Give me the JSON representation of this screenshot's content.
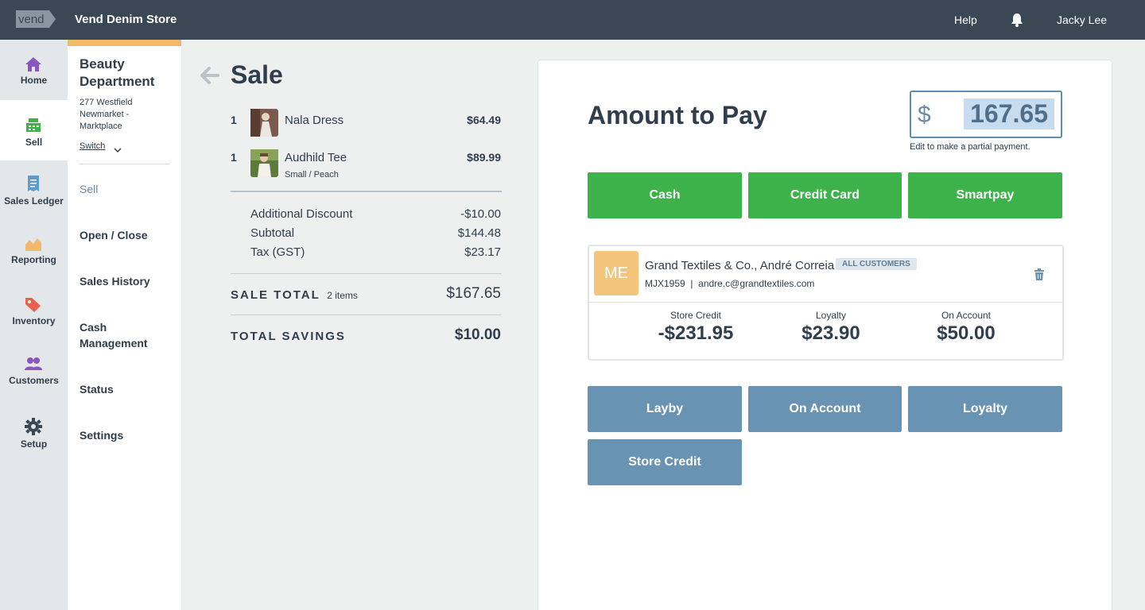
{
  "topbar": {
    "logo_text": "vend",
    "store_name": "Vend Denim Store",
    "help": "Help",
    "user": "Jacky Lee",
    "bell_icon": "bell-icon"
  },
  "leftnav": {
    "items": [
      {
        "label": "Home",
        "icon": "home-icon",
        "color": "#8a56c0"
      },
      {
        "label": "Sell",
        "icon": "register-icon",
        "color": "#3db14a"
      },
      {
        "label": "Sales Ledger",
        "icon": "receipt-icon",
        "color": "#5d9ad0"
      },
      {
        "label": "Reporting",
        "icon": "chart-icon",
        "color": "#f2b96b"
      },
      {
        "label": "Inventory",
        "icon": "tag-icon",
        "color": "#e8614c"
      },
      {
        "label": "Customers",
        "icon": "people-icon",
        "color": "#8a56c0"
      },
      {
        "label": "Setup",
        "icon": "gear-icon",
        "color": "#3a4855"
      }
    ]
  },
  "submenu": {
    "outlet": "Beauty Department",
    "address": "277 Westfield Newmarket - Marktplace",
    "switch": "Switch",
    "items": [
      "Sell",
      "Open / Close",
      "Sales History",
      "Cash Management",
      "Status",
      "Settings"
    ]
  },
  "sale": {
    "title": "Sale",
    "lines": [
      {
        "qty": "1",
        "name": "Nala Dress",
        "variant": "",
        "price": "$64.49"
      },
      {
        "qty": "1",
        "name": "Audhild Tee",
        "variant": "Small / Peach",
        "price": "$89.99"
      }
    ],
    "summary": [
      {
        "label": "Additional Discount",
        "value": "-$10.00"
      },
      {
        "label": "Subtotal",
        "value": "$144.48"
      },
      {
        "label": "Tax (GST)",
        "value": "$23.17"
      }
    ],
    "total_label": "SALE TOTAL",
    "total_items": "2 items",
    "total_value": "$167.65",
    "savings_label": "TOTAL SAVINGS",
    "savings_value": "$10.00"
  },
  "payment": {
    "title": "Amount to Pay",
    "currency": "$",
    "amount": "167.65",
    "hint": "Edit to make a partial payment.",
    "primary_buttons": [
      "Cash",
      "Credit Card",
      "Smartpay"
    ],
    "secondary_buttons": [
      "Layby",
      "On Account",
      "Loyalty",
      "Store Credit"
    ],
    "colors": {
      "green": "#3db14a",
      "blue": "#6993b3",
      "highlight": "#c8dcf0"
    }
  },
  "customer": {
    "initials": "ME",
    "name": "Grand Textiles & Co., André Correia",
    "badge": "ALL CUSTOMERS",
    "code": "MJX1959",
    "email": "andre.c@grandtextiles.com",
    "code_line": "MJX1959  |  andre.c@grandtextiles.com",
    "stats": [
      {
        "label": "Store Credit",
        "value": "-$231.95"
      },
      {
        "label": "Loyalty",
        "value": "$23.90"
      },
      {
        "label": "On Account",
        "value": "$50.00"
      }
    ]
  }
}
